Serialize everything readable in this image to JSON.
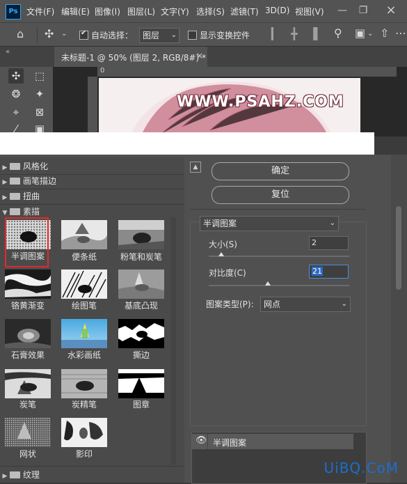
{
  "app": {
    "logo_text": "Ps"
  },
  "menu": [
    "文件(F)",
    "编辑(E)",
    "图像(I)",
    "图层(L)",
    "文字(Y)",
    "选择(S)",
    "滤镜(T)",
    "3D(D)",
    "视图(V)"
  ],
  "options_bar": {
    "auto_select_label": "自动选择：",
    "auto_select_checked": true,
    "auto_select_value": "图层",
    "show_transform_label": "显示变换控件",
    "show_transform_checked": false
  },
  "document": {
    "tab_title": "未标题-1 @ 50% (图层 2, RGB/8#) *",
    "close_symbol": "×",
    "ruler_origin": "0",
    "canvas_watermark": "WWW.PSAHZ.COM"
  },
  "filter_gallery": {
    "categories": [
      {
        "name": "风格化",
        "expanded": false
      },
      {
        "name": "画笔描边",
        "expanded": false
      },
      {
        "name": "扭曲",
        "expanded": false
      },
      {
        "name": "素描",
        "expanded": true
      }
    ],
    "bottom_category": {
      "name": "纹理",
      "expanded": false
    },
    "filters": [
      "半调图案",
      "便条纸",
      "粉笔和炭笔",
      "铬黄渐变",
      "绘图笔",
      "基底凸现",
      "石膏效果",
      "水彩画纸",
      "撕边",
      "炭笔",
      "炭精笔",
      "图章",
      "网状",
      "影印"
    ],
    "selected_filter": "半调图案",
    "ok_label": "确定",
    "reset_label": "复位",
    "current_filter_dropdown": "半调图案",
    "params": {
      "size_label": "大小(S)",
      "size_value": "2",
      "size_fraction": 0.09,
      "contrast_label": "对比度(C)",
      "contrast_value": "21",
      "contrast_fraction": 0.42,
      "pattern_type_label": "图案类型(P):",
      "pattern_type_value": "网点"
    },
    "effect_layer_name": "半调图案"
  },
  "watermark": "UiBQ.CoM",
  "colors": {
    "selection_red": "#e22a2a",
    "ps_blue": "#31a8ff",
    "watermark_blue": "#1a6fd0"
  }
}
